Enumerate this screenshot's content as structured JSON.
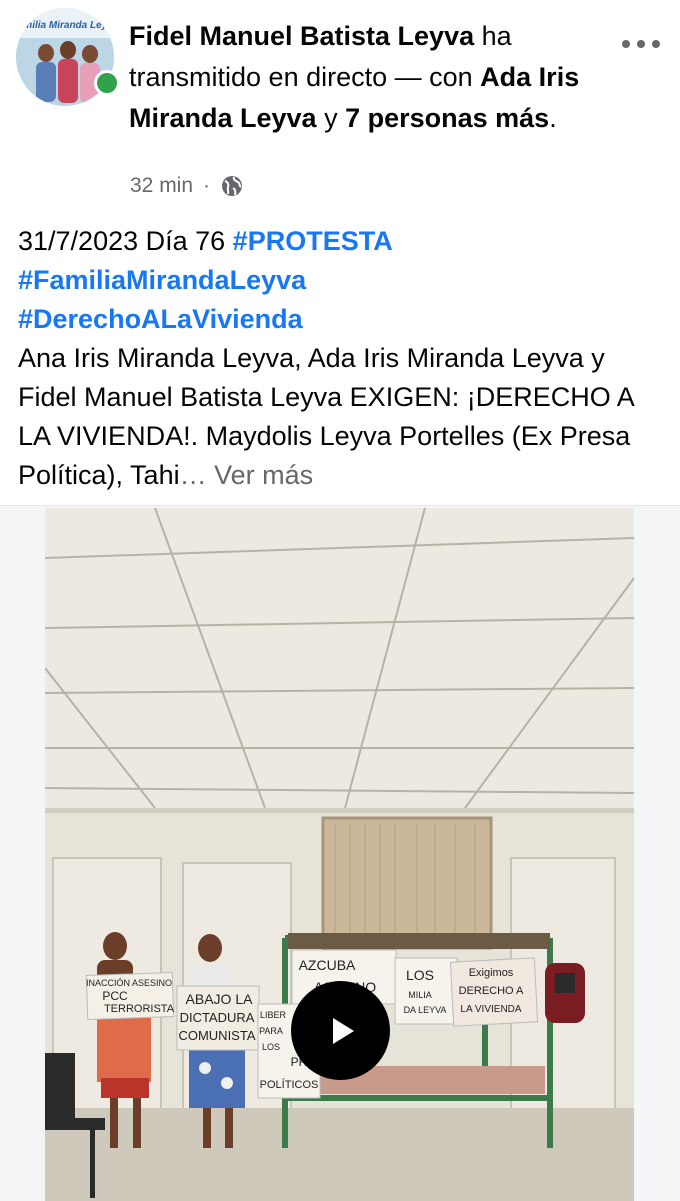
{
  "post": {
    "author": "Fidel Manuel Batista Leyva",
    "action_text": " ha transmitido en directo — con ",
    "tagged_person": "Ada Iris Miranda Leyva",
    "and_text": " y ",
    "others": "7 personas más",
    "period": ".",
    "avatar_caption": "Familia Miranda Leyva",
    "time": "32 min",
    "dot": "·",
    "privacy_icon": "globe-icon",
    "body": {
      "date_prefix": "31/7/2023 Día 76 ",
      "hashtags": [
        "#PROTESTA",
        "#FamiliaMirandaLeyva",
        "#DerechoALaVivienda"
      ],
      "text": "Ana Iris Miranda Leyva, Ada Iris Miranda Leyva y Fidel Manuel Batista Leyva EXIGEN: ¡DERECHO A LA VIVIENDA!. Maydolis Leyva Portelles (Ex Presa Política), Tahi",
      "ellipsis": "…",
      "see_more": "Ver más"
    }
  },
  "media": {
    "signs": {
      "sign1_line1": "INACCIÓN ASESINO",
      "sign1_line2": "PCC",
      "sign1_line3": "TERRORISTA",
      "sign2_line1": "ABAJO LA",
      "sign2_line2": "DICTADURA",
      "sign2_line3": "COMUNISTA",
      "sign3_line1": "LIBER",
      "sign3_line2": "PARA",
      "sign3_line3": "LOS",
      "sign3_line4": "PRE",
      "sign3_line5": "POLÍTICOS",
      "sign4_line1": "AZCUBA",
      "sign4_line2": "ASESINO",
      "sign5_line1": "LOS",
      "sign5_line2": "MILIA",
      "sign5_line3": "DA LEYVA",
      "sign6_line1": "Exigimos",
      "sign6_line2": "DERECHO A",
      "sign6_line3": "LA VIVIENDA"
    },
    "play_icon": "play-icon"
  },
  "colors": {
    "link": "#1877f2",
    "secondary_text": "#65676b",
    "online": "#31a24c"
  }
}
